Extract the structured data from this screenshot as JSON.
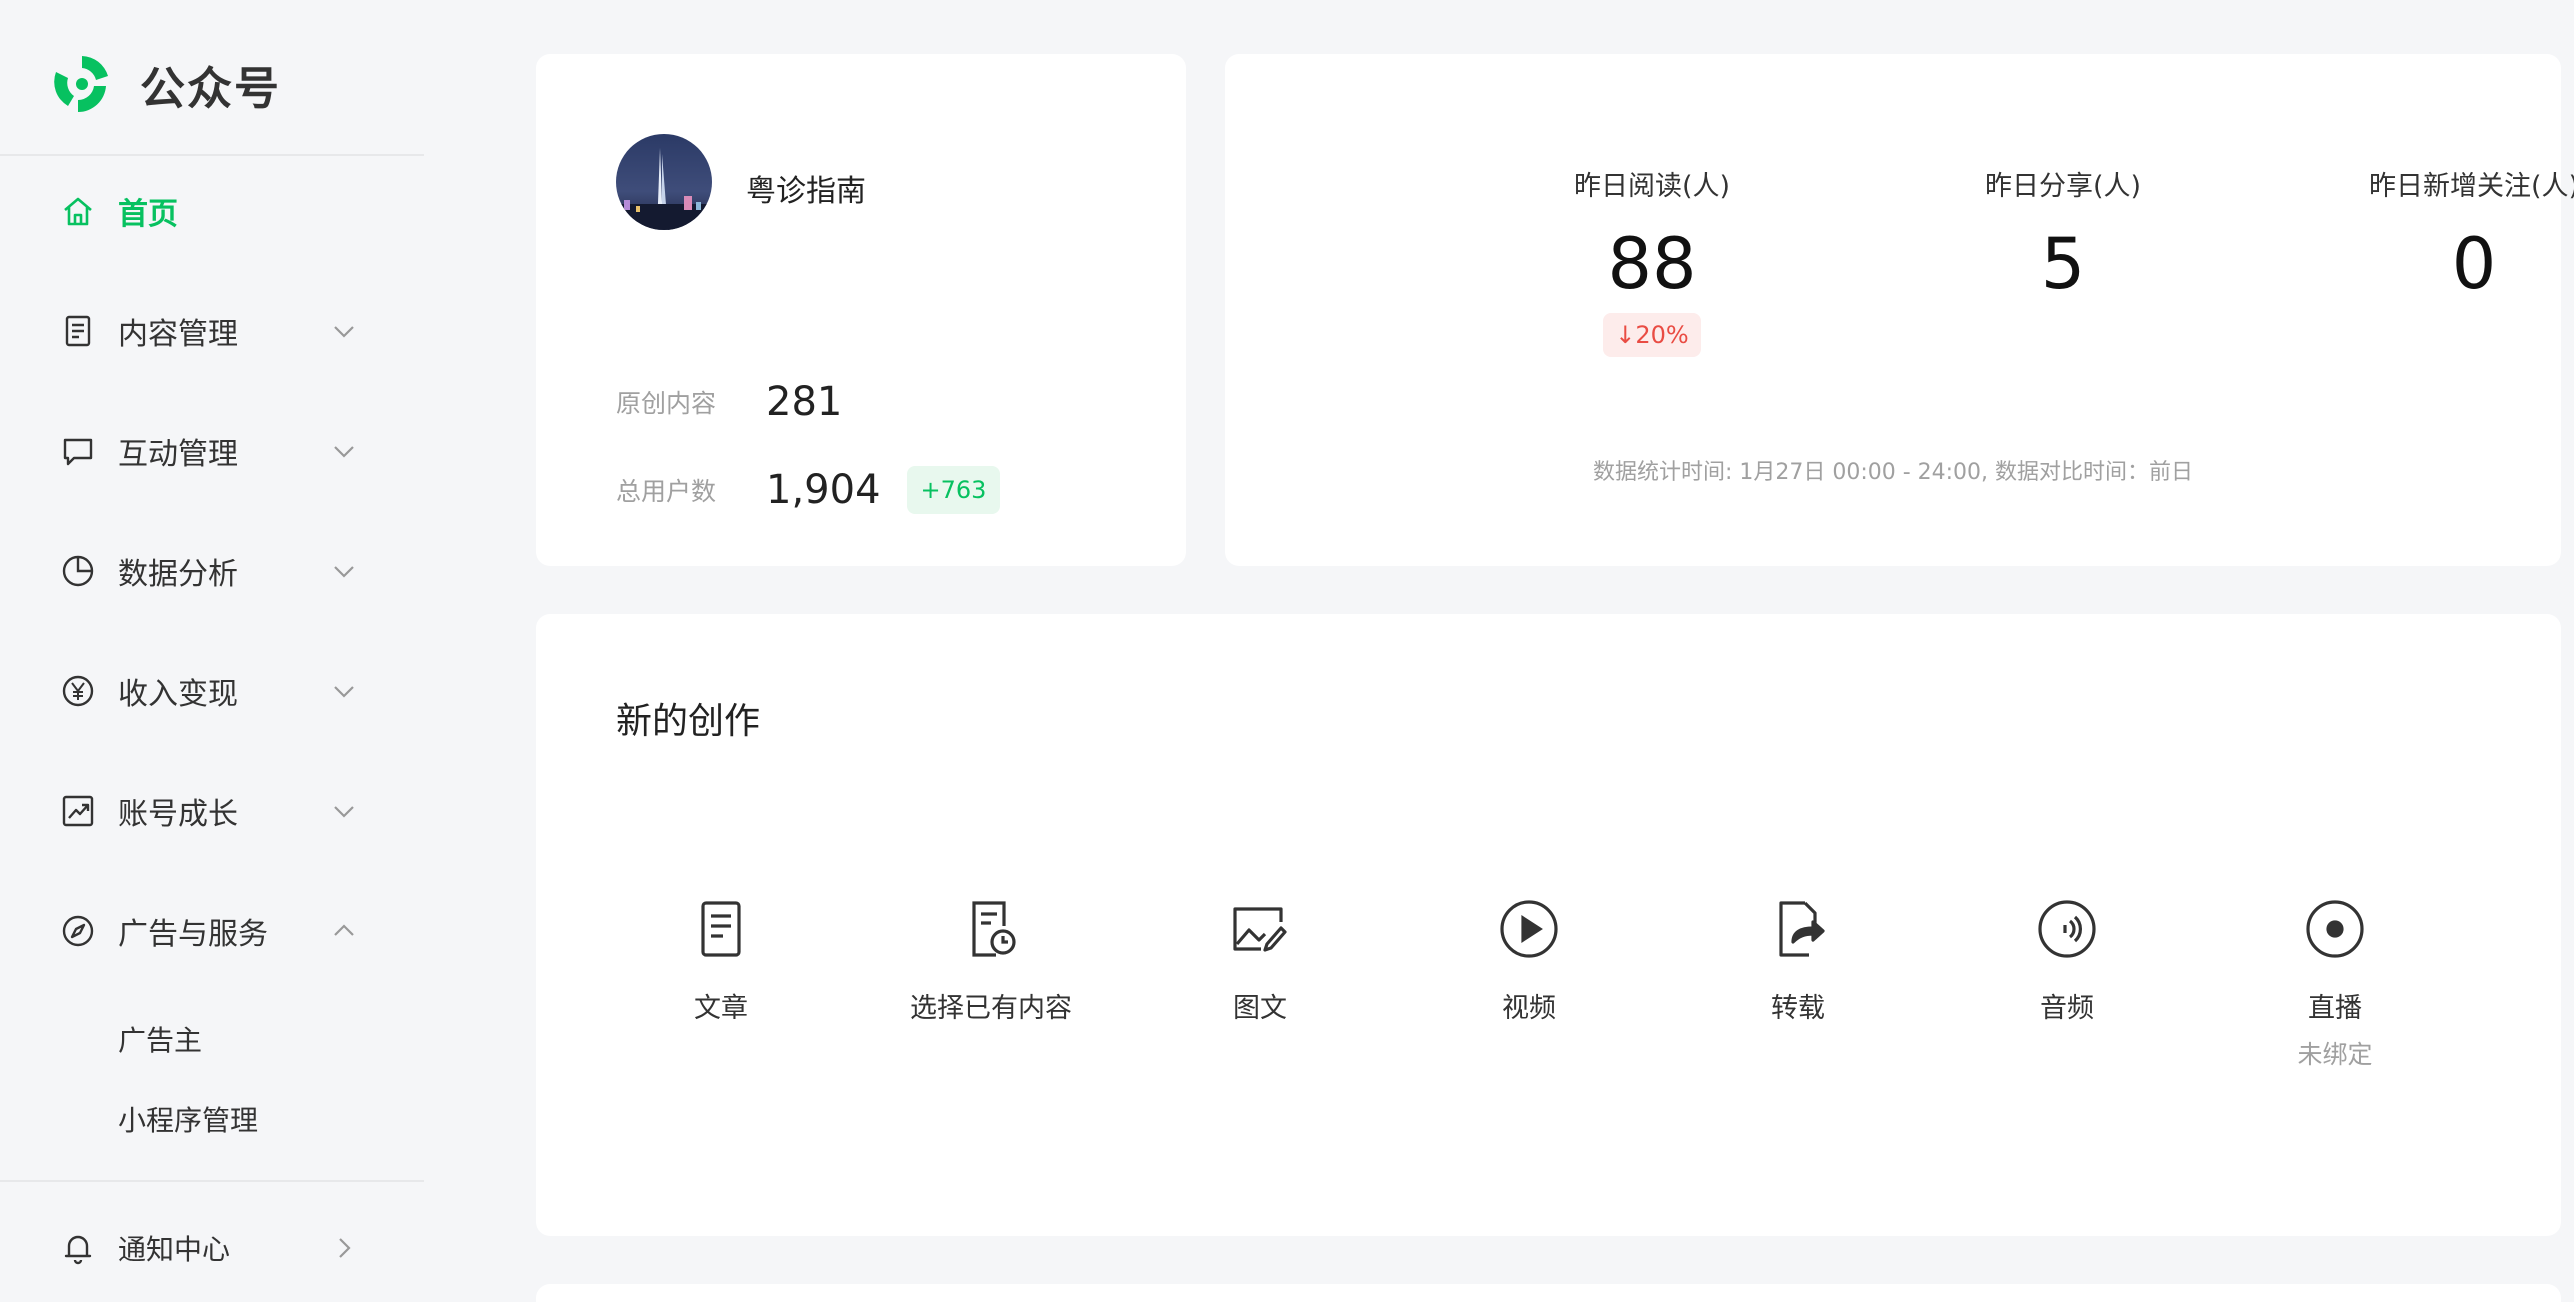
{
  "brand": {
    "name": "公众号",
    "accent": "#07c160"
  },
  "sidebar": {
    "items": [
      {
        "label": "首页",
        "icon": "home-icon",
        "active": true
      },
      {
        "label": "内容管理",
        "icon": "document-icon"
      },
      {
        "label": "互动管理",
        "icon": "chat-icon"
      },
      {
        "label": "数据分析",
        "icon": "pie-chart-icon"
      },
      {
        "label": "收入变现",
        "icon": "yen-icon"
      },
      {
        "label": "账号成长",
        "icon": "trend-icon"
      },
      {
        "label": "广告与服务",
        "icon": "compass-icon",
        "expanded": true
      }
    ],
    "subitems": [
      "广告主",
      "小程序管理"
    ],
    "notification": {
      "label": "通知中心",
      "icon": "bell-icon"
    }
  },
  "profile": {
    "name": "粤诊指南",
    "original_label": "原创内容",
    "original_value": "281",
    "users_label": "总用户数",
    "users_value": "1,904",
    "users_delta": "+763"
  },
  "metrics": {
    "items": [
      {
        "label": "昨日阅读(人)",
        "value": "88",
        "change": "↓20%"
      },
      {
        "label": "昨日分享(人)",
        "value": "5"
      },
      {
        "label": "昨日新增关注(人)",
        "value": "0"
      }
    ],
    "note": "数据统计时间: 1月27日 00:00 - 24:00, 数据对比时间：前日"
  },
  "create": {
    "title": "新的创作",
    "items": [
      {
        "label": "文章",
        "icon": "article-icon"
      },
      {
        "label": "选择已有内容",
        "icon": "existing-content-icon"
      },
      {
        "label": "图文",
        "icon": "image-text-icon"
      },
      {
        "label": "视频",
        "icon": "video-play-icon"
      },
      {
        "label": "转载",
        "icon": "repost-icon"
      },
      {
        "label": "音频",
        "icon": "audio-icon"
      },
      {
        "label": "直播",
        "icon": "live-icon",
        "sub": "未绑定"
      }
    ]
  }
}
